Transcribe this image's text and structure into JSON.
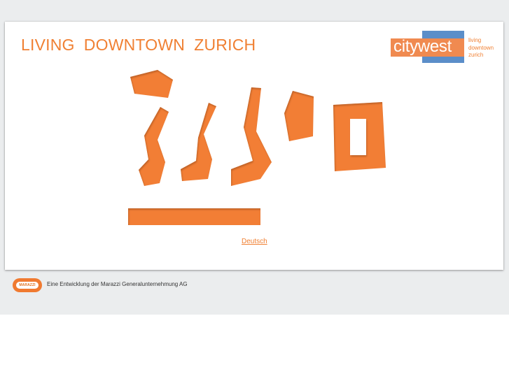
{
  "header": {
    "title": "LIVING  DOWNTOWN  ZURICH"
  },
  "logo": {
    "wordmark": "citywest",
    "tagline": [
      "living",
      "downtown",
      "zurich"
    ]
  },
  "language_link": "Deutsch",
  "footer": {
    "badge_text": "MARAZZI",
    "text": "Eine Entwicklung der Marazzi Generalunternehmung AG"
  },
  "colors": {
    "accent_orange": "#f08033",
    "logo_blue": "#5b8ec9",
    "background_band": "#ebedee"
  }
}
